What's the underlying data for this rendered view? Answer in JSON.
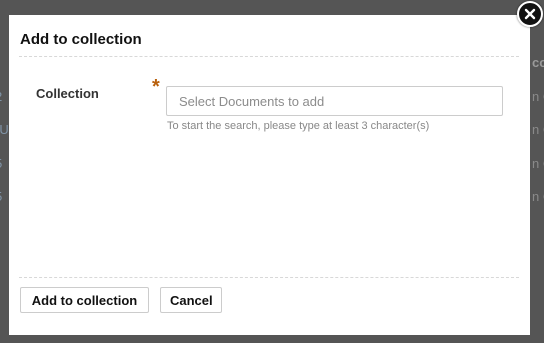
{
  "background": {
    "left_edge_rows": [
      "2",
      "-U",
      "5",
      "5"
    ],
    "right_edge_header": "co",
    "right_edge_rows": [
      "n C",
      "n C",
      "n C",
      "n C"
    ]
  },
  "modal": {
    "title": "Add to collection",
    "field": {
      "label": "Collection",
      "required_mark": "*",
      "placeholder": "Select Documents to add",
      "value": "",
      "help_text": "To start the search, please type at least 3 character(s)"
    },
    "buttons": {
      "submit_label": "Add to collection",
      "cancel_label": "Cancel"
    },
    "close_icon": "close-icon"
  },
  "colors": {
    "required_star": "#b8600c",
    "overlay": "#555555"
  }
}
